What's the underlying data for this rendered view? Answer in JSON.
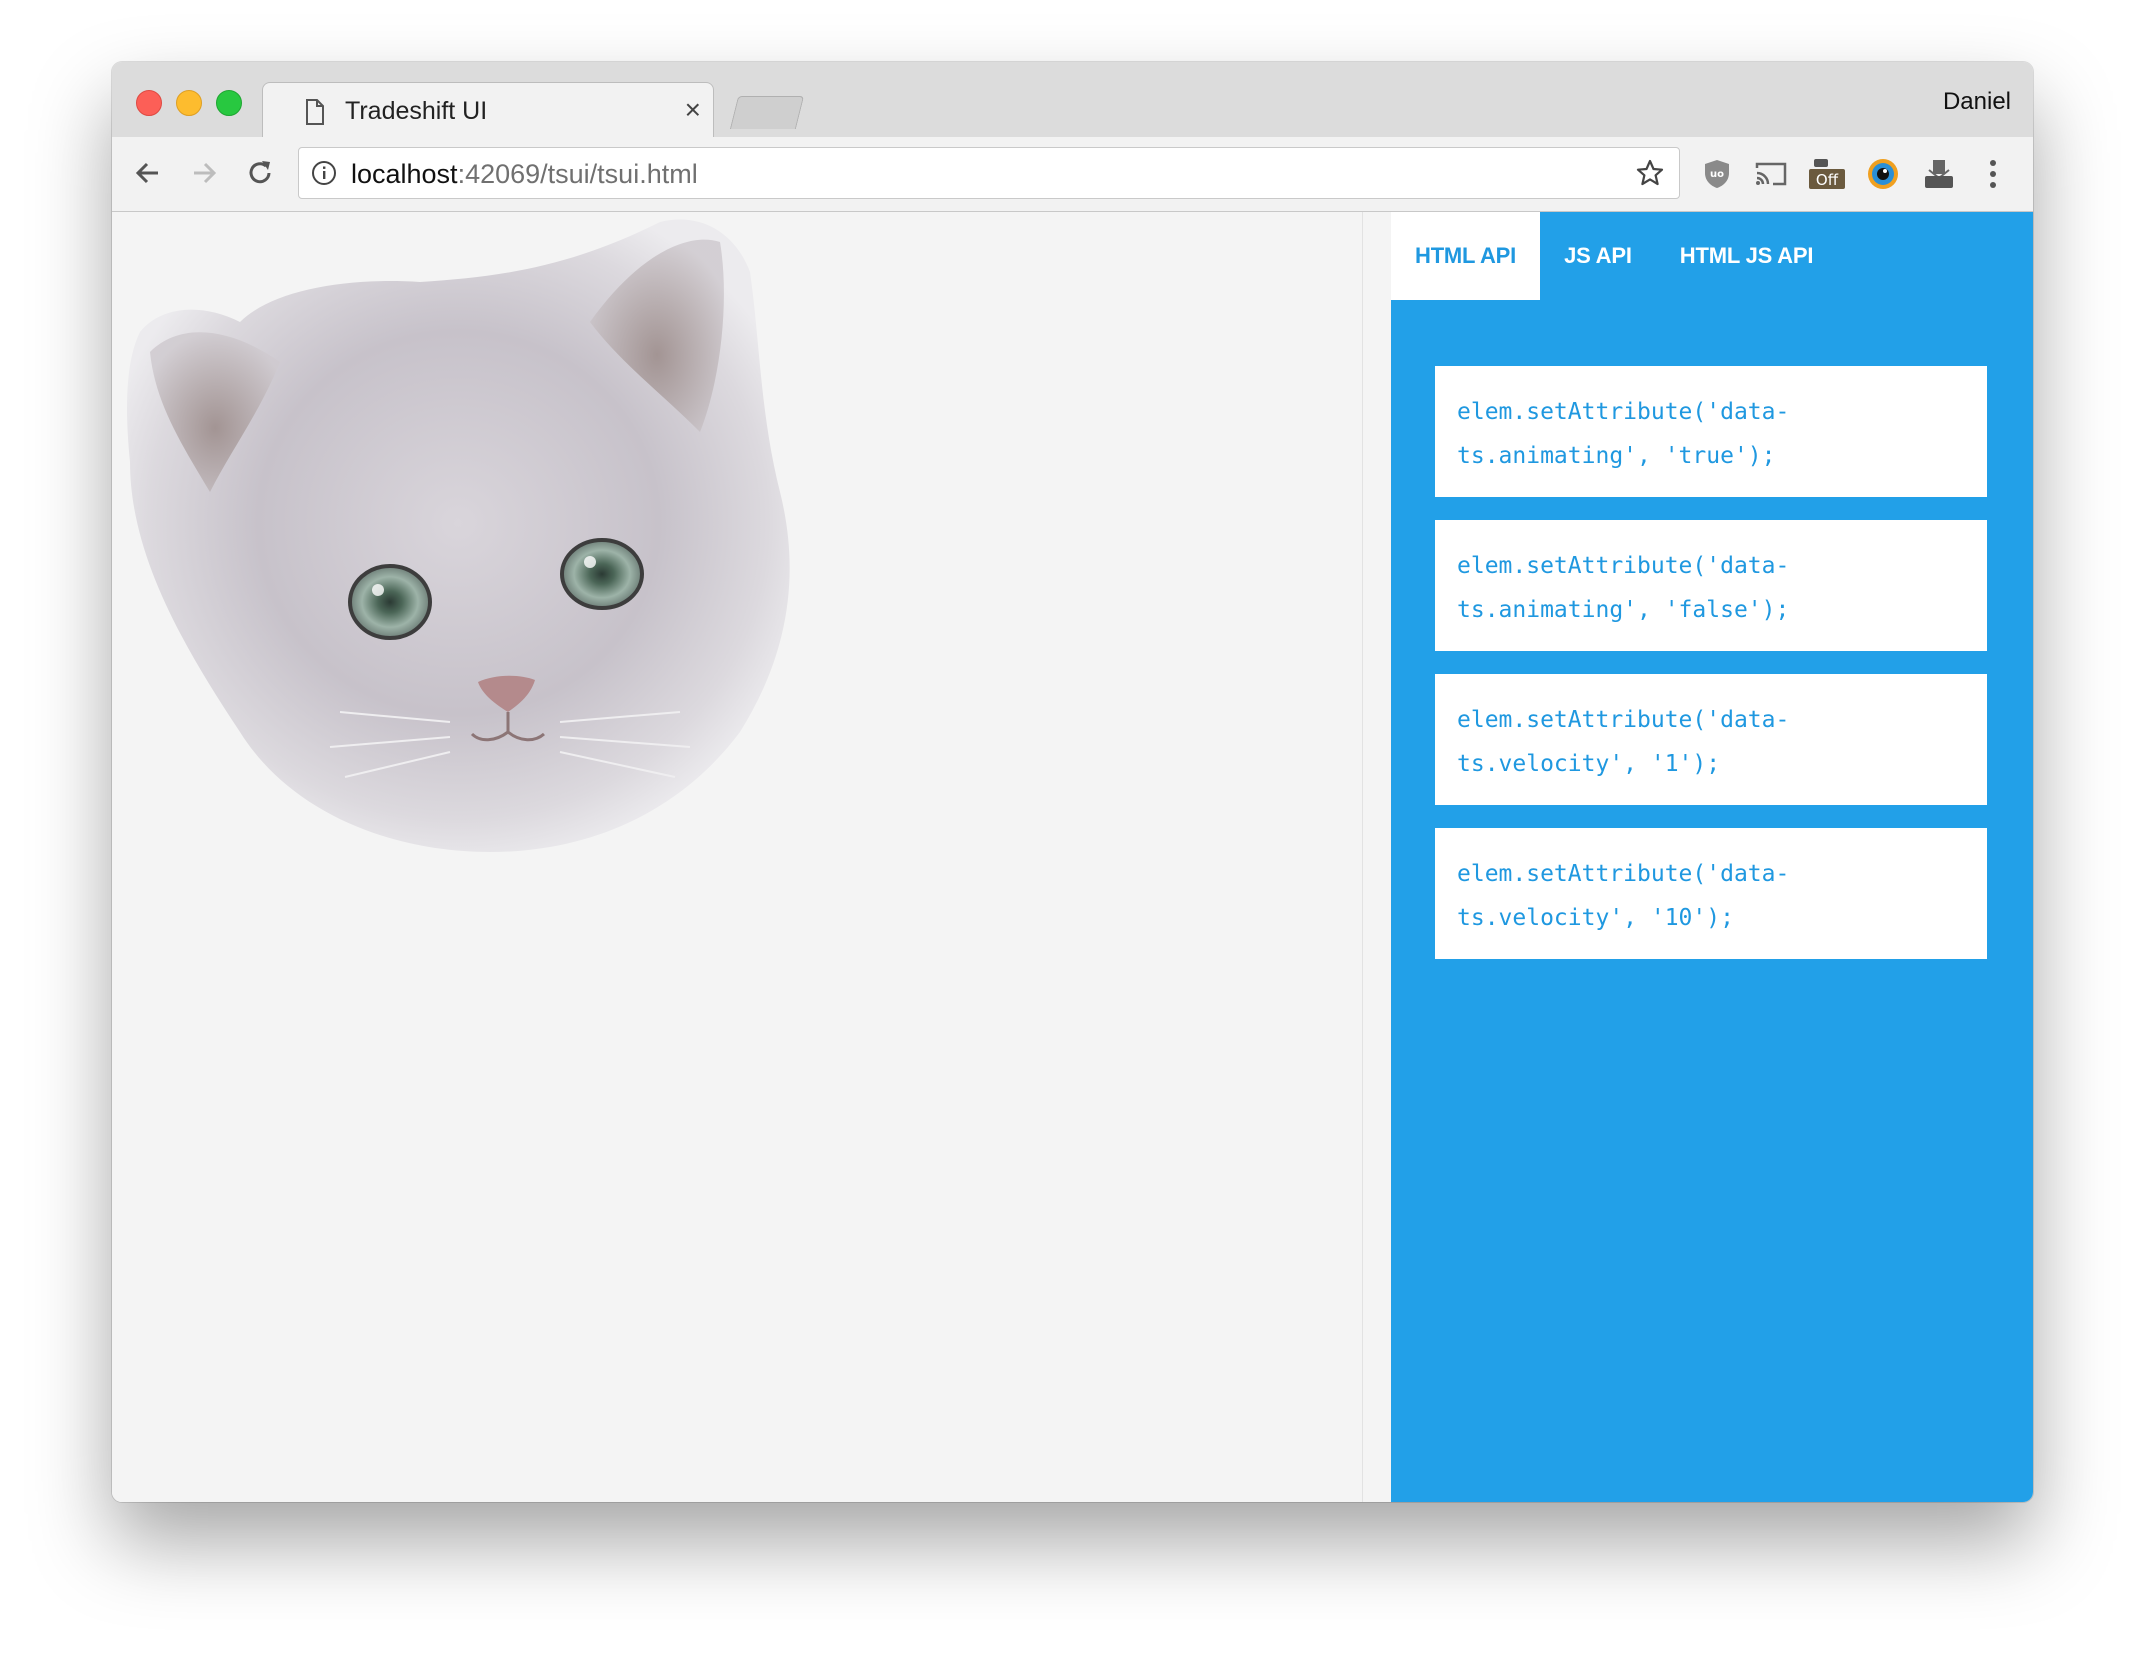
{
  "browser": {
    "tab_title": "Tradeshift UI",
    "tab_close": "×",
    "profile_name": "Daniel",
    "url_host": "localhost",
    "url_path": ":42069/tsui/tsui.html",
    "extensions": {
      "off_badge": "Off"
    }
  },
  "aside": {
    "tabs": [
      {
        "label": "HTML API",
        "active": true
      },
      {
        "label": "JS API",
        "active": false
      },
      {
        "label": "HTML JS API",
        "active": false
      }
    ],
    "snippets": [
      {
        "code": "elem.setAttribute('data-\nts.animating', 'true');"
      },
      {
        "code": "elem.setAttribute('data-\nts.animating', 'false');"
      },
      {
        "code": "elem.setAttribute('data-\nts.velocity', '1');"
      },
      {
        "code": "elem.setAttribute('data-\nts.velocity', '10');"
      }
    ]
  },
  "colors": {
    "aside_background": "#22a0e8",
    "accent_text": "#1f98e0",
    "page_background": "#f4f4f4"
  },
  "icons": [
    "document-icon",
    "close-icon",
    "back-icon",
    "forward-icon",
    "reload-icon",
    "info-icon",
    "star-icon",
    "shield-icon",
    "cast-icon",
    "off-extension-icon",
    "eye-extension-icon",
    "inbox-icon",
    "menu-icon"
  ]
}
